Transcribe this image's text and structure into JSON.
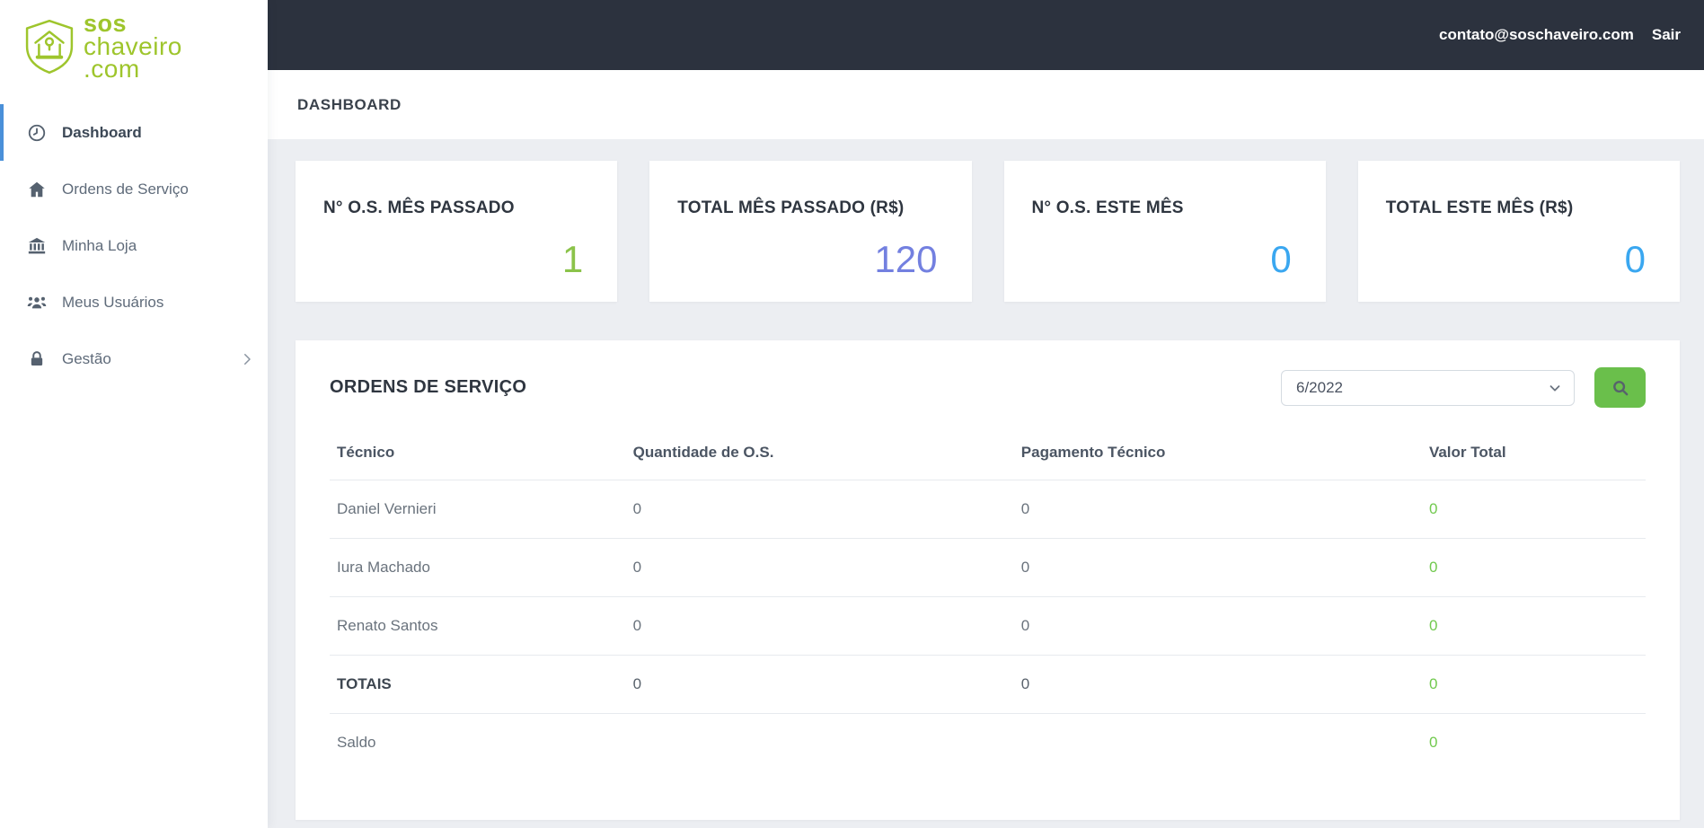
{
  "brand": {
    "logo_line1": "sos",
    "logo_line2": "chaveiro",
    "logo_line3": ".com",
    "logo_color": "#9ec52c"
  },
  "topbar": {
    "email": "contato@soschaveiro.com",
    "logout_label": "Sair",
    "bg_color": "#2c323e"
  },
  "sidebar": {
    "active_indicator_color": "#4a90d9",
    "items": [
      {
        "label": "Dashboard",
        "icon": "clock-icon",
        "active": true
      },
      {
        "label": "Ordens de Serviço",
        "icon": "home-icon",
        "active": false
      },
      {
        "label": "Minha Loja",
        "icon": "bank-icon",
        "active": false
      },
      {
        "label": "Meus Usuários",
        "icon": "users-icon",
        "active": false
      },
      {
        "label": "Gestão",
        "icon": "lock-icon",
        "active": false,
        "has_submenu": true
      }
    ]
  },
  "page_header": {
    "title": "DASHBOARD"
  },
  "stat_cards": [
    {
      "label": "N° O.S. MÊS PASSADO",
      "value": "1",
      "value_color": "#8bc34a"
    },
    {
      "label": "TOTAL MÊS PASSADO (R$)",
      "value": "120",
      "value_color": "#7380e0"
    },
    {
      "label": "N° O.S. ESTE MÊS",
      "value": "0",
      "value_color": "#3aa7f0"
    },
    {
      "label": "TOTAL ESTE MÊS (R$)",
      "value": "0",
      "value_color": "#3aa7f0"
    }
  ],
  "orders_panel": {
    "title": "ORDENS DE SERVIÇO",
    "period_value": "6/2022",
    "search_button_color": "#6abf4b",
    "table": {
      "value_color": "#71c94e",
      "headers": [
        "Técnico",
        "Quantidade de O.S.",
        "Pagamento Técnico",
        "Valor Total"
      ],
      "rows": [
        {
          "tecnico": "Daniel Vernieri",
          "quantidade": "0",
          "pagamento": "0",
          "valor": "0"
        },
        {
          "tecnico": "Iura Machado",
          "quantidade": "0",
          "pagamento": "0",
          "valor": "0"
        },
        {
          "tecnico": "Renato Santos",
          "quantidade": "0",
          "pagamento": "0",
          "valor": "0"
        },
        {
          "tecnico": "TOTAIS",
          "quantidade": "0",
          "pagamento": "0",
          "valor": "0"
        },
        {
          "tecnico": "Saldo",
          "quantidade": "",
          "pagamento": "",
          "valor": "0"
        }
      ]
    }
  }
}
